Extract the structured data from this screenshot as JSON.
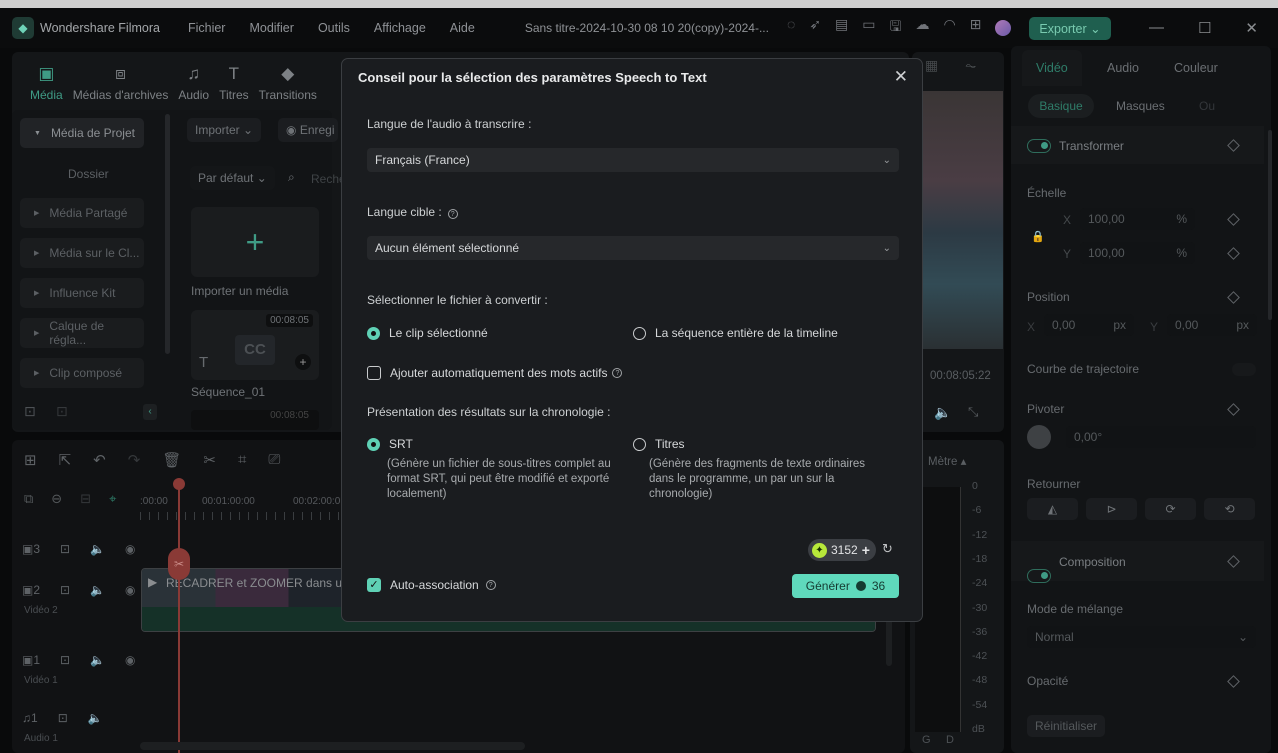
{
  "titlebar": {
    "app_name": "Wondershare Filmora",
    "menu": [
      "Fichier",
      "Modifier",
      "Outils",
      "Affichage",
      "Aide"
    ],
    "project_title": "Sans titre-2024-10-30 08 10 20(copy)-2024-...",
    "export_label": "Exporter"
  },
  "left_panel": {
    "tabs": [
      {
        "label": "Média",
        "icon": "image-icon"
      },
      {
        "label": "Médias d'archives",
        "icon": "cloud-folder-icon"
      },
      {
        "label": "Audio",
        "icon": "music-note-icon"
      },
      {
        "label": "Titres",
        "icon": "text-t-icon"
      },
      {
        "label": "Transitions",
        "icon": "transition-icon"
      }
    ],
    "sidebar": [
      "Média de Projet",
      "Dossier",
      "Média Partagé",
      "Média sur le Cl...",
      "Influence Kit",
      "Calque de régla...",
      "Clip composé"
    ],
    "import_label": "Importer",
    "record_label": "Enregi",
    "sort_label": "Par défaut",
    "search_placeholder": "Reche",
    "import_media_label": "Importer un média",
    "sequence_name": "Séquence_01",
    "sequence_duration": "00:08:05",
    "next_duration": "00:08:05",
    "cc_label": "CC"
  },
  "preview": {
    "timecode": "00:08:05:22"
  },
  "meter": {
    "label": "Mètre",
    "scale": [
      "0",
      "-6",
      "-12",
      "-18",
      "-24",
      "-30",
      "-36",
      "-42",
      "-48",
      "-54",
      "dB"
    ],
    "channels": [
      "G",
      "D"
    ]
  },
  "timeline": {
    "ruler": [
      ":00:00",
      "00:01:00:00",
      "00:02:00:0"
    ],
    "clip_title": "RECADRER et ZOOMER dans une",
    "tracks": [
      {
        "id": "3",
        "name": ""
      },
      {
        "id": "2",
        "name": "Vidéo 2"
      },
      {
        "id": "1",
        "name": "Vidéo 1"
      },
      {
        "id": "1",
        "name": "Audio 1",
        "audio": true
      }
    ]
  },
  "right_panel": {
    "tabs": [
      "Vidéo",
      "Audio",
      "Couleur"
    ],
    "subtabs": [
      "Basique",
      "Masques",
      "Ou"
    ],
    "transform_label": "Transformer",
    "scale_label": "Échelle",
    "scale_x": "100,00",
    "scale_y": "100,00",
    "percent": "%",
    "x": "X",
    "y": "Y",
    "position_label": "Position",
    "pos_x": "0,00",
    "pos_y": "0,00",
    "px": "px",
    "trajectory_label": "Courbe de trajectoire",
    "rotate_label": "Pivoter",
    "rotate_value": "0,00°",
    "flip_label": "Retourner",
    "composition_label": "Composition",
    "blend_label": "Mode de mélange",
    "blend_value": "Normal",
    "opacity_label": "Opacité",
    "reset_label": "Réinitialiser"
  },
  "dialog": {
    "title": "Conseil pour la sélection des paramètres Speech to Text",
    "source_lang_label": "Langue de l'audio à transcrire :",
    "source_lang_value": "Français (France)",
    "target_lang_label": "Langue cible :",
    "target_lang_value": "Aucun élément sélectionné",
    "file_label": "Sélectionner le fichier à convertir :",
    "file_options": [
      "Le clip sélectionné",
      "La séquence entière de la timeline"
    ],
    "file_selected": 0,
    "active_words_label": "Ajouter automatiquement des mots actifs",
    "active_words_checked": false,
    "output_label": "Présentation des résultats sur la chronologie :",
    "output_options": [
      {
        "label": "SRT",
        "desc": "(Génère un fichier de sous-titres complet au format SRT, qui peut être modifié et exporté localement)"
      },
      {
        "label": "Titres",
        "desc": "(Génère des fragments de texte ordinaires dans le programme, un par un sur la chronologie)"
      }
    ],
    "output_selected": 0,
    "credits": "3152",
    "auto_assoc_label": "Auto-association",
    "auto_assoc_checked": true,
    "generate_label": "Générer",
    "generate_cost": "36",
    "accent": "#5fd9bc"
  }
}
